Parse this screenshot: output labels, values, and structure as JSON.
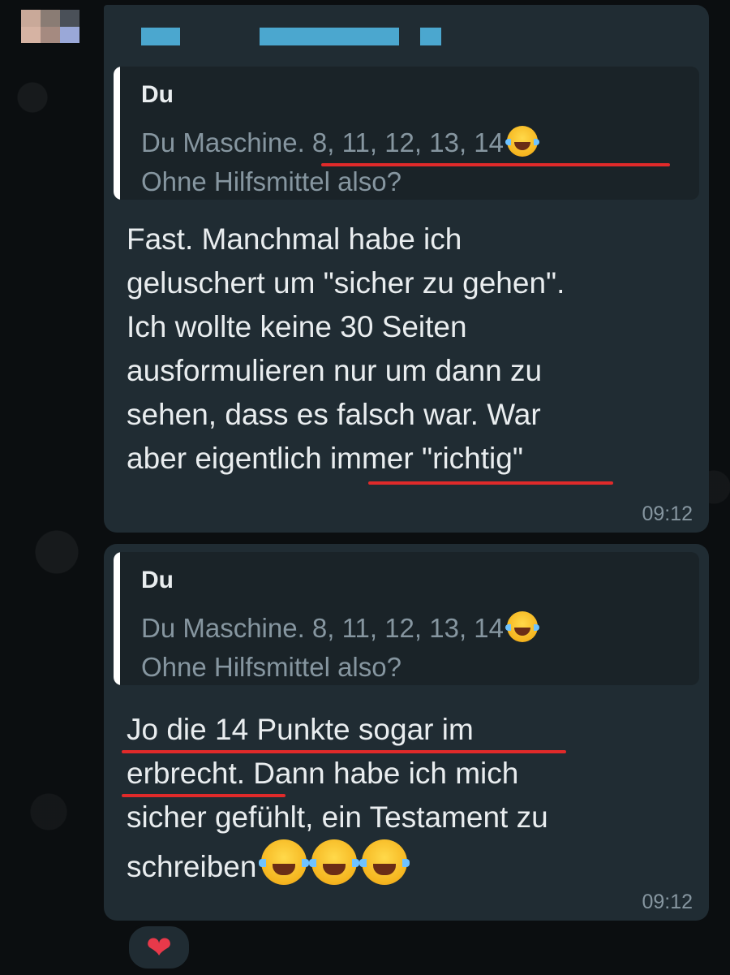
{
  "messages": [
    {
      "quote": {
        "author": "Du",
        "text": "Du Maschine. 8, 11, 12, 13, 14",
        "emoji": "tears-of-joy-emoji",
        "text2": "Ohne Hilfsmittel also?"
      },
      "lines": [
        "Fast. Manchmal habe ich",
        "geluschert um \"sicher zu gehen\".",
        "Ich wollte keine 30 Seiten",
        "ausformulieren nur um dann zu",
        "sehen, dass es falsch war. War",
        "aber eigentlich immer \"richtig\""
      ],
      "time": "09:12"
    },
    {
      "quote": {
        "author": "Du",
        "text": "Du Maschine. 8, 11, 12, 13, 14",
        "emoji": "tears-of-joy-emoji",
        "text2": "Ohne Hilfsmittel also?"
      },
      "lines": [
        "Jo die 14 Punkte sogar im",
        "erbrecht. Dann habe ich mich",
        "sicher gefühlt, ein Testament zu",
        "schreiben"
      ],
      "trailing_emojis": [
        "tears-of-joy-emoji",
        "tears-of-joy-emoji",
        "tears-of-joy-emoji"
      ],
      "time": "09:12"
    }
  ],
  "reaction": {
    "emoji": "❤",
    "icon": "red-heart-icon"
  },
  "colors": {
    "background": "#0b0e10",
    "bubble": "#202c33",
    "quote_background": "#1a2328",
    "annotation": "#e02a2a"
  }
}
